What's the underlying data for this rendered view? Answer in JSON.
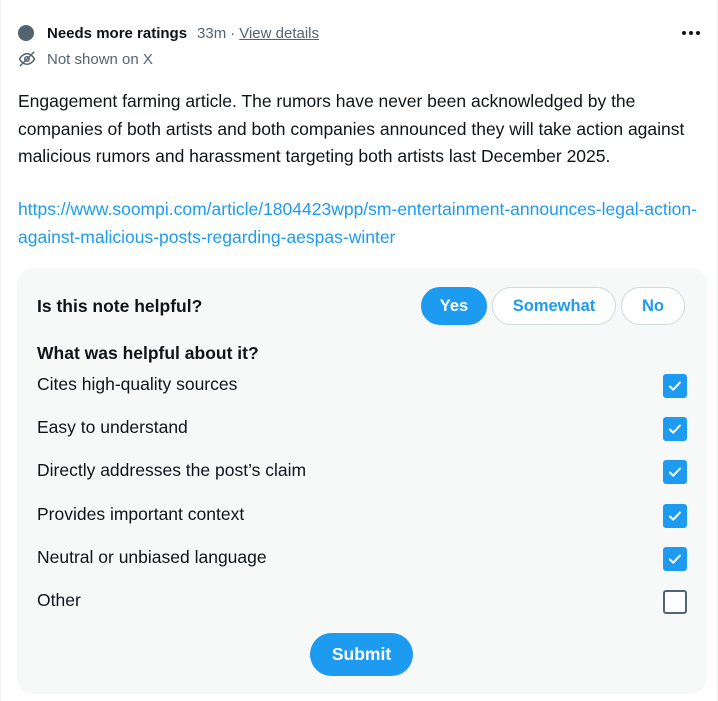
{
  "header": {
    "status_label": "Needs more ratings",
    "time": "33m",
    "separator": "·",
    "view_details": "View details",
    "visibility": "Not shown on X"
  },
  "note": {
    "text": "Engagement farming article. The rumors have never been acknowledged by the companies of both artists and both companies announced they will take action against malicious rumors and harassment targeting both artists last December 2025.",
    "link": "https://www.soompi.com/article/1804423wpp/sm-entertainment-announces-legal-action-against-malicious-posts-regarding-aespas-winter"
  },
  "rating": {
    "question": "Is this note helpful?",
    "options": {
      "yes": "Yes",
      "somewhat": "Somewhat",
      "no": "No"
    },
    "selected": "Yes",
    "helpful_title": "What was helpful about it?",
    "reasons": [
      {
        "label": "Cites high-quality sources",
        "checked": true
      },
      {
        "label": "Easy to understand",
        "checked": true
      },
      {
        "label": "Directly addresses the post’s claim",
        "checked": true
      },
      {
        "label": "Provides important context",
        "checked": true
      },
      {
        "label": "Neutral or unbiased language",
        "checked": true
      },
      {
        "label": "Other",
        "checked": false
      }
    ],
    "submit": "Submit"
  },
  "colors": {
    "accent": "#1d9bf0",
    "text_primary": "#0f1419",
    "text_secondary": "#536471",
    "panel_bg": "#f7f9f9"
  },
  "icons": {
    "status": "status-dot-icon",
    "visibility": "eye-slash-icon",
    "more": "more-horizontal-icon",
    "check": "checkmark-icon"
  }
}
